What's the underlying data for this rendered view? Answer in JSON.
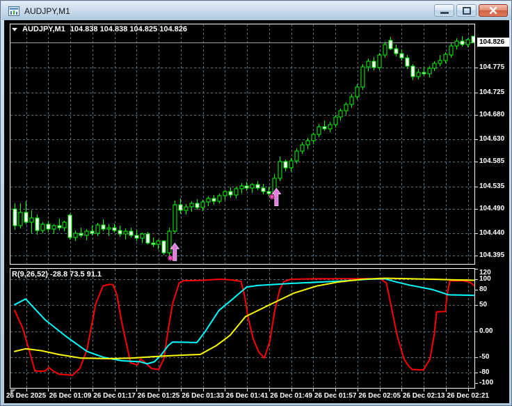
{
  "window": {
    "title": "AUDJPY,M1"
  },
  "titlebar_buttons": {
    "minimize": "minimize",
    "restore": "restore",
    "close": "close"
  },
  "chart": {
    "info": {
      "symbol": "AUDJPY,M1",
      "ohlc": "104.838 104.838 104.825 104.826"
    },
    "current_price_label": "104.826",
    "price_axis_labels": [
      "104.775",
      "104.725",
      "104.680",
      "104.630",
      "104.585",
      "104.535",
      "104.490",
      "104.440",
      "104.395"
    ],
    "indicator_label": "R(9,26,52) -28.8 73.5 91.1",
    "indicator_axis_labels": [
      "120",
      "100",
      "80",
      "50",
      "0.00",
      "-50",
      "-80",
      "-100"
    ],
    "time_axis": [
      "26 Dec 2025",
      "26 Dec 01:09",
      "26 Dec 01:17",
      "26 Dec 01:25",
      "26 Dec 01:33",
      "26 Dec 01:41",
      "26 Dec 01:49",
      "26 Dec 01:57",
      "26 Dec 02:05",
      "26 Dec 02:13",
      "26 Dec 02:21"
    ]
  },
  "colors": {
    "background": "#000000",
    "grid": "#5f7280",
    "candle_outline": "#00ff00",
    "bull_fill": "#000000",
    "bear_fill": "#ffffff",
    "bid_line": "#9a9a9a",
    "arrow_fill": "#df7bdf",
    "arrow_edge": "#f2b8f2",
    "star": "#ff4dc4",
    "red_line": "#ff0000",
    "cyan_line": "#00ffff",
    "yellow_line": "#ffff00"
  },
  "chart_data": {
    "type": "candlestick",
    "symbol": "AUDJPY,M1",
    "timeframe": "M1",
    "start_time": "00:59",
    "interval_minutes": 1,
    "current_price": 104.826,
    "price_ticks": [
      104.775,
      104.725,
      104.68,
      104.63,
      104.585,
      104.535,
      104.49,
      104.44,
      104.395
    ],
    "ohlc": [
      [
        104.49,
        104.5,
        104.447,
        104.455
      ],
      [
        104.455,
        104.5,
        104.45,
        104.483
      ],
      [
        104.483,
        104.505,
        104.458,
        104.462
      ],
      [
        104.462,
        104.487,
        104.44,
        104.471
      ],
      [
        104.471,
        104.478,
        104.437,
        104.446
      ],
      [
        104.446,
        104.462,
        104.44,
        104.458
      ],
      [
        104.458,
        104.465,
        104.442,
        104.449
      ],
      [
        104.449,
        104.459,
        104.438,
        104.455
      ],
      [
        104.455,
        104.47,
        104.446,
        104.451
      ],
      [
        104.451,
        104.466,
        104.444,
        104.462
      ],
      [
        104.476,
        104.48,
        104.428,
        104.432
      ],
      [
        104.432,
        104.446,
        104.424,
        104.44
      ],
      [
        104.44,
        104.452,
        104.432,
        104.436
      ],
      [
        104.436,
        104.448,
        104.426,
        104.444
      ],
      [
        104.444,
        104.456,
        104.436,
        104.44
      ],
      [
        104.44,
        104.461,
        104.435,
        104.457
      ],
      [
        104.457,
        104.468,
        104.444,
        104.448
      ],
      [
        104.448,
        104.458,
        104.434,
        104.452
      ],
      [
        104.452,
        104.46,
        104.441,
        104.446
      ],
      [
        104.446,
        104.455,
        104.433,
        104.438
      ],
      [
        104.438,
        104.45,
        104.428,
        104.444
      ],
      [
        104.444,
        104.452,
        104.432,
        104.436
      ],
      [
        104.436,
        104.447,
        104.424,
        104.43
      ],
      [
        104.43,
        104.442,
        104.42,
        104.438
      ],
      [
        104.438,
        104.443,
        104.417,
        104.421
      ],
      [
        104.421,
        104.432,
        104.412,
        104.417
      ],
      [
        104.417,
        104.428,
        104.408,
        104.424
      ],
      [
        104.424,
        104.426,
        104.396,
        104.4
      ],
      [
        104.4,
        104.452,
        104.395,
        104.445
      ],
      [
        104.445,
        104.506,
        104.44,
        104.498
      ],
      [
        104.498,
        104.51,
        104.48,
        104.487
      ],
      [
        104.487,
        104.499,
        104.478,
        104.494
      ],
      [
        104.494,
        104.505,
        104.484,
        104.501
      ],
      [
        104.501,
        104.509,
        104.488,
        104.492
      ],
      [
        104.492,
        104.507,
        104.485,
        104.503
      ],
      [
        104.503,
        104.515,
        104.495,
        104.511
      ],
      [
        104.511,
        104.518,
        104.498,
        104.505
      ],
      [
        104.505,
        104.52,
        104.5,
        104.516
      ],
      [
        104.516,
        104.528,
        104.507,
        104.524
      ],
      [
        104.524,
        104.533,
        104.512,
        104.518
      ],
      [
        104.518,
        104.535,
        104.51,
        104.53
      ],
      [
        104.53,
        104.541,
        104.521,
        104.536
      ],
      [
        104.536,
        104.545,
        104.526,
        104.531
      ],
      [
        104.531,
        104.542,
        104.522,
        104.538
      ],
      [
        104.538,
        104.546,
        104.527,
        104.532
      ],
      [
        104.532,
        104.54,
        104.519,
        104.524
      ],
      [
        104.524,
        104.535,
        104.515,
        104.52
      ],
      [
        104.52,
        104.56,
        104.516,
        104.552
      ],
      [
        104.552,
        104.595,
        104.546,
        104.585
      ],
      [
        104.585,
        104.59,
        104.566,
        104.572
      ],
      [
        104.572,
        104.592,
        104.565,
        104.587
      ],
      [
        104.587,
        104.612,
        104.581,
        104.606
      ],
      [
        104.606,
        104.624,
        104.6,
        104.619
      ],
      [
        104.619,
        104.633,
        104.611,
        104.628
      ],
      [
        104.628,
        104.645,
        104.62,
        104.64
      ],
      [
        104.64,
        104.661,
        104.634,
        104.656
      ],
      [
        104.656,
        104.668,
        104.647,
        104.652
      ],
      [
        104.652,
        104.665,
        104.644,
        104.66
      ],
      [
        104.66,
        104.68,
        104.654,
        104.675
      ],
      [
        104.675,
        104.692,
        104.668,
        104.688
      ],
      [
        104.688,
        104.705,
        104.68,
        104.7
      ],
      [
        104.7,
        104.722,
        104.694,
        104.716
      ],
      [
        104.716,
        104.742,
        104.71,
        104.736
      ],
      [
        104.736,
        104.782,
        104.73,
        104.776
      ],
      [
        104.776,
        104.793,
        104.768,
        104.788
      ],
      [
        104.788,
        104.796,
        104.77,
        104.775
      ],
      [
        104.775,
        104.805,
        104.77,
        104.8
      ],
      [
        104.8,
        104.828,
        104.795,
        104.822
      ],
      [
        104.83,
        104.837,
        104.81,
        104.813
      ],
      [
        104.813,
        104.822,
        104.798,
        104.804
      ],
      [
        104.804,
        104.812,
        104.789,
        104.795
      ],
      [
        104.795,
        104.8,
        104.772,
        104.778
      ],
      [
        104.778,
        104.782,
        104.75,
        104.757
      ],
      [
        104.757,
        104.772,
        104.752,
        104.766
      ],
      [
        104.766,
        104.776,
        104.758,
        104.762
      ],
      [
        104.762,
        104.778,
        104.756,
        104.774
      ],
      [
        104.774,
        104.788,
        104.768,
        104.784
      ],
      [
        104.784,
        104.8,
        104.778,
        104.79
      ],
      [
        104.79,
        104.806,
        104.784,
        104.802
      ],
      [
        104.8,
        104.824,
        104.795,
        104.819
      ],
      [
        104.819,
        104.834,
        104.812,
        104.829
      ],
      [
        104.829,
        104.838,
        104.817,
        104.822
      ],
      [
        104.822,
        104.835,
        104.816,
        104.832
      ],
      [
        104.838,
        104.838,
        104.825,
        104.826
      ]
    ],
    "signals": [
      {
        "type": "buy-arrow",
        "candle": 29,
        "tip_price": 104.42,
        "star_candle": 28.2,
        "star_price": 104.39
      },
      {
        "type": "buy-arrow",
        "candle": 47.4,
        "tip_price": 104.531,
        "star_candle": 46.6,
        "star_price": 104.514
      }
    ],
    "indicator": {
      "name": "R(9,26,52)",
      "values_label": "-28.8 73.5 91.1",
      "axis_ticks": [
        120,
        100,
        80,
        50,
        0,
        -50,
        -80,
        -100
      ],
      "levels": [
        100,
        50,
        0,
        -50,
        -80
      ],
      "range": [
        122,
        -111
      ],
      "series": [
        {
          "name": "fast",
          "color": "#ff0000",
          "points": [
            [
              0,
              40
            ],
            [
              1.5,
              5
            ],
            [
              3.7,
              -77
            ],
            [
              5.5,
              -77
            ],
            [
              6.2,
              -70
            ],
            [
              7,
              -77
            ],
            [
              8,
              -83
            ],
            [
              10.5,
              -85
            ],
            [
              11.8,
              -72
            ],
            [
              13.1,
              -36
            ],
            [
              14.7,
              53
            ],
            [
              16,
              87
            ],
            [
              17,
              90
            ],
            [
              17.8,
              90
            ],
            [
              18.5,
              71
            ],
            [
              19.4,
              17
            ],
            [
              20.3,
              -27
            ],
            [
              21,
              -61
            ],
            [
              22.2,
              -65
            ],
            [
              22.8,
              -54
            ],
            [
              23.5,
              -59
            ],
            [
              24.8,
              -72
            ],
            [
              26.1,
              -74
            ],
            [
              27,
              -54
            ],
            [
              27.7,
              -5
            ],
            [
              28.6,
              53
            ],
            [
              29.8,
              93
            ],
            [
              30.5,
              97
            ],
            [
              34,
              98
            ],
            [
              37,
              100
            ],
            [
              39,
              99
            ],
            [
              41,
              96
            ],
            [
              41.6,
              70
            ],
            [
              42.3,
              25
            ],
            [
              43.2,
              -15
            ],
            [
              44.2,
              -40
            ],
            [
              45.2,
              -52
            ],
            [
              46.2,
              -20
            ],
            [
              47.1,
              40
            ],
            [
              48,
              80
            ],
            [
              48.7,
              95
            ],
            [
              50,
              100
            ],
            [
              55,
              101
            ],
            [
              60,
              101
            ],
            [
              64,
              101
            ],
            [
              66.3,
              100
            ],
            [
              67.3,
              93
            ],
            [
              68,
              57
            ],
            [
              69.3,
              -10
            ],
            [
              70.5,
              -54
            ],
            [
              71.4,
              -68
            ],
            [
              72,
              -74
            ],
            [
              74,
              -75
            ],
            [
              75.2,
              -54
            ],
            [
              76,
              -5
            ],
            [
              76.4,
              37
            ],
            [
              78,
              38
            ],
            [
              78.3,
              70
            ],
            [
              78.8,
              97
            ],
            [
              81.2,
              97
            ],
            [
              82.5,
              94
            ],
            [
              83.5,
              85
            ]
          ]
        },
        {
          "name": "mid",
          "color": "#00ffff",
          "points": [
            [
              0,
              51
            ],
            [
              2,
              62
            ],
            [
              5.5,
              22
            ],
            [
              9.3,
              -10
            ],
            [
              13.1,
              -39
            ],
            [
              16,
              -50
            ],
            [
              19.4,
              -57
            ],
            [
              22.8,
              -59
            ],
            [
              24,
              -63
            ],
            [
              25.3,
              -59
            ],
            [
              26.6,
              -45
            ],
            [
              27.8,
              -28
            ],
            [
              28.6,
              -21
            ],
            [
              33,
              -22
            ],
            [
              34.5,
              -1
            ],
            [
              37,
              40
            ],
            [
              39.5,
              62
            ],
            [
              42,
              85
            ],
            [
              44,
              88
            ],
            [
              50,
              92
            ],
            [
              56,
              95
            ],
            [
              60,
              97
            ],
            [
              64,
              100
            ],
            [
              67,
              101
            ],
            [
              69,
              95
            ],
            [
              71.4,
              89
            ],
            [
              75.7,
              80
            ],
            [
              77.7,
              73
            ],
            [
              78.6,
              70
            ],
            [
              83.5,
              69
            ]
          ]
        },
        {
          "name": "slow",
          "color": "#ffff00",
          "points": [
            [
              0,
              -39
            ],
            [
              2,
              -34
            ],
            [
              5,
              -38
            ],
            [
              8,
              -45
            ],
            [
              12,
              -52
            ],
            [
              17,
              -53
            ],
            [
              21,
              -52
            ],
            [
              24,
              -50
            ],
            [
              27,
              -48
            ],
            [
              29,
              -47
            ],
            [
              31,
              -46
            ],
            [
              33.6,
              -45
            ],
            [
              36.5,
              -28
            ],
            [
              39,
              -8
            ],
            [
              41.8,
              28
            ],
            [
              46.2,
              51
            ],
            [
              50.5,
              73
            ],
            [
              54.7,
              87
            ],
            [
              58.8,
              95
            ],
            [
              63.1,
              100
            ],
            [
              67,
              102
            ],
            [
              71.4,
              101
            ],
            [
              75.7,
              100
            ],
            [
              79,
              99
            ],
            [
              83.5,
              98
            ]
          ]
        }
      ]
    }
  }
}
